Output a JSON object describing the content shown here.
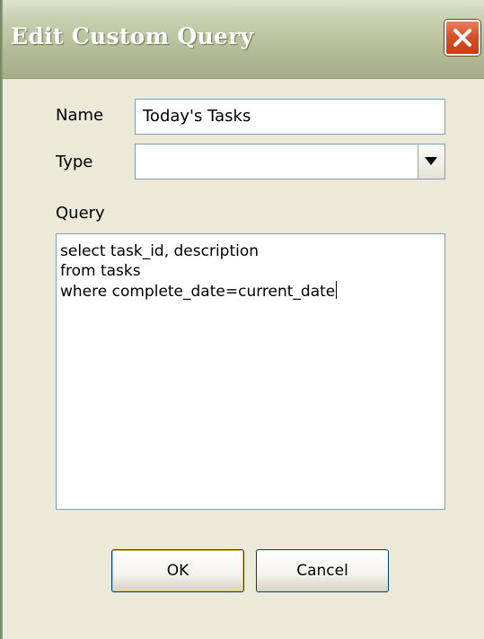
{
  "window": {
    "title": "Edit Custom Query"
  },
  "form": {
    "name_label": "Name",
    "name_value": "Today's Tasks",
    "type_label": "Type",
    "type_value": "",
    "query_label": "Query",
    "query_lines": [
      "select task_id, description",
      "from tasks",
      "where complete_date=current_date"
    ]
  },
  "buttons": {
    "ok_label": "OK",
    "cancel_label": "Cancel"
  },
  "icons": {
    "close": "close-icon",
    "dropdown": "chevron-down-icon"
  },
  "colors": {
    "titlebar": "#b8c09c",
    "close_button": "#d8522a",
    "dialog_background": "#ece9d8",
    "field_border": "#7f9db9"
  }
}
